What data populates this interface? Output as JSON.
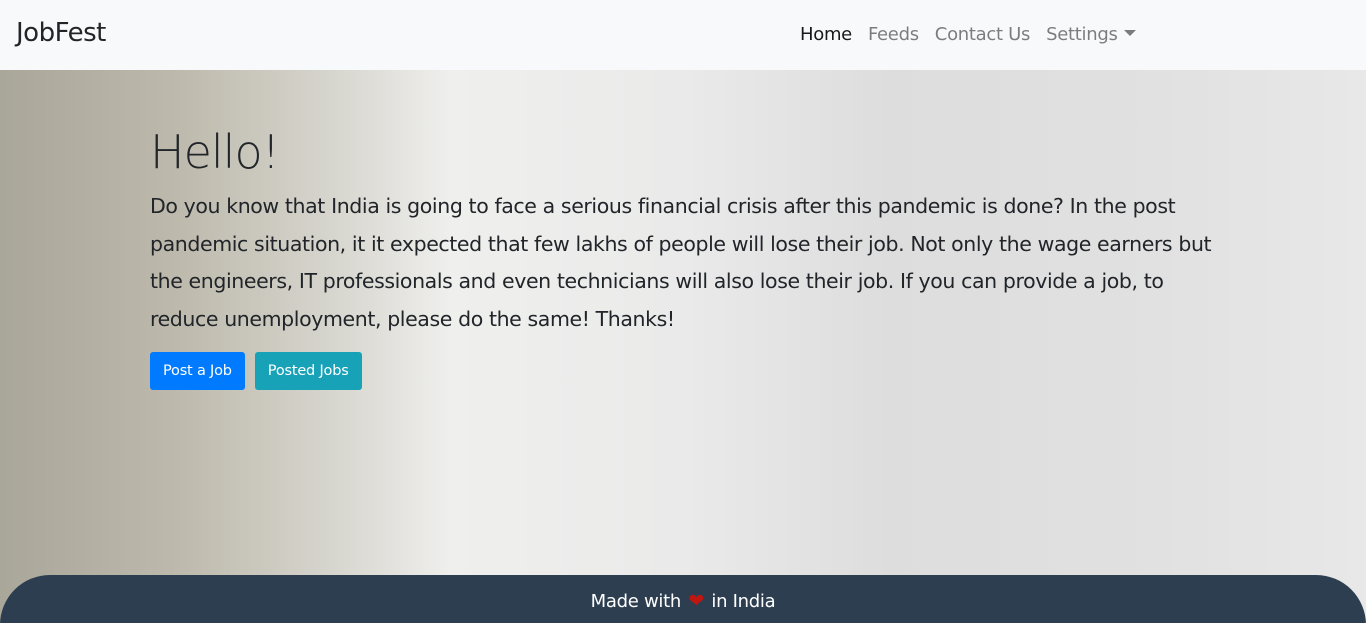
{
  "navbar": {
    "brand": "JobFest",
    "items": [
      {
        "label": "Home",
        "active": true
      },
      {
        "label": "Feeds",
        "active": false
      },
      {
        "label": "Contact Us",
        "active": false
      },
      {
        "label": "Settings",
        "active": false,
        "dropdown": true
      }
    ]
  },
  "hero": {
    "title": "Hello!",
    "paragraph": "Do you know that India is going to face a serious financial crisis after this pandemic is done? In the post pandemic situation, it it expected that few lakhs of people will lose their job. Not only the wage earners but the engineers, IT professionals and even technicians will also lose their job. If you can provide a job, to reduce unemployment, please do the same! Thanks!",
    "buttons": {
      "post_job": "Post a Job",
      "posted_jobs": "Posted Jobs"
    }
  },
  "footer": {
    "prefix": "Made with",
    "icon": "heart-icon",
    "suffix": "in India"
  },
  "colors": {
    "navbar_bg": "#f8f9fa",
    "primary": "#007bff",
    "info": "#17a2b8",
    "footer_bg": "#2c3e50",
    "heart": "#c0160f"
  }
}
